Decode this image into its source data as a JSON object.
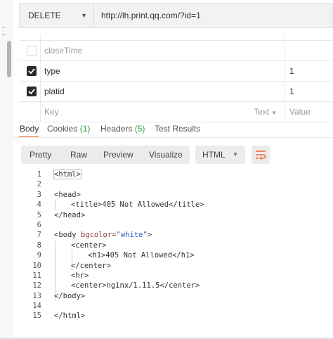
{
  "request": {
    "method": "DELETE",
    "url": "http://lh.print.qq.com/?id=1"
  },
  "params": {
    "rows": [
      {
        "key": "closeTime",
        "value": "",
        "checked": false,
        "muted": true
      },
      {
        "key": "type",
        "value": "1",
        "checked": true,
        "muted": false
      },
      {
        "key": "platid",
        "value": "1",
        "checked": true,
        "muted": false
      }
    ],
    "new_row": {
      "key_placeholder": "Key",
      "type_label": "Text",
      "value_placeholder": "Value"
    }
  },
  "response_tabs": {
    "body": "Body",
    "cookies": "Cookies",
    "cookies_count": "(1)",
    "headers": "Headers",
    "headers_count": "(5)",
    "test_results": "Test Results"
  },
  "view_modes": [
    "Pretty",
    "Raw",
    "Preview",
    "Visualize"
  ],
  "format": "HTML",
  "icons": {
    "method_dropdown": "chevron-down-icon",
    "checkbox": "check-icon",
    "wrap": "wrap-lines-icon"
  },
  "colors": {
    "accent": "#ef6c2d",
    "count": "#27a046",
    "attr": "#8b3a3a",
    "string": "#2b50c8"
  },
  "code": {
    "line_numbers": [
      "1",
      "2",
      "3",
      "4",
      "5",
      "6",
      "7",
      "8",
      "9",
      "10",
      "11",
      "12",
      "13",
      "14",
      "15"
    ],
    "l1": "<html>",
    "l3": "<head>",
    "l4_indent": "    ",
    "l4": "<title>405 Not Allowed</title>",
    "l5": "</head>",
    "l7_tag": "<body ",
    "l7_attr": "bgcolor=",
    "l7_str": "\"white\"",
    "l7_close": ">",
    "l8": "<center>",
    "l9": "<h1>405 Not Allowed</h1>",
    "l10": "</center>",
    "l11": "<hr>",
    "l12": "<center>nginx/1.11.5</center>",
    "l13": "</body>",
    "l15": "</html>"
  }
}
